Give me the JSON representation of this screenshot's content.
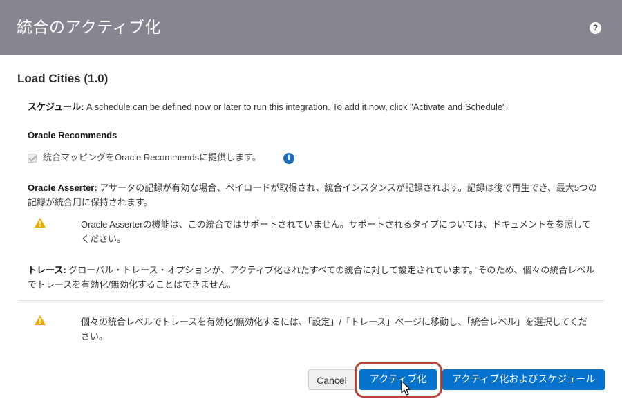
{
  "dialog": {
    "title": "統合のアクティブ化",
    "help_icon": "?"
  },
  "integration": {
    "name": "Load Cities (1.0)"
  },
  "schedule": {
    "label": "スケジュール:",
    "text": " A schedule can be defined now or later to run this integration. To add it now, click \"Activate and Schedule\"."
  },
  "recommends": {
    "heading": "Oracle Recommends",
    "checkbox_label": "統合マッピングをOracle Recommendsに提供します。",
    "checked": true,
    "info_icon": "i"
  },
  "asserter": {
    "label": "Oracle Asserter:",
    "text": " アサータの記録が有効な場合、ペイロードが取得され、統合インスタンスが記録されます。記録は後で再生でき、最大5つの記録が統合用に保持されます。",
    "warning": "Oracle Asserterの機能は、この統合ではサポートされていません。サポートされるタイプについては、ドキュメントを参照してください。"
  },
  "trace": {
    "label": "トレース:",
    "text": " グローバル・トレース・オプションが、アクティブ化されたすべての統合に対して設定されています。そのため、個々の統合レベルでトレースを有効化/無効化することはできません。",
    "warning": "個々の統合レベルでトレースを有効化/無効化するには、「設定」/「トレース」ページに移動し、「統合レベル」を選択してください。"
  },
  "buttons": {
    "cancel": "Cancel",
    "activate": "アクティブ化",
    "activate_schedule": "アクティブ化およびスケジュール"
  },
  "colors": {
    "header_bg": "#858690",
    "primary": "#0572ce",
    "warning": "#f0a800",
    "highlight": "#b8443a"
  }
}
